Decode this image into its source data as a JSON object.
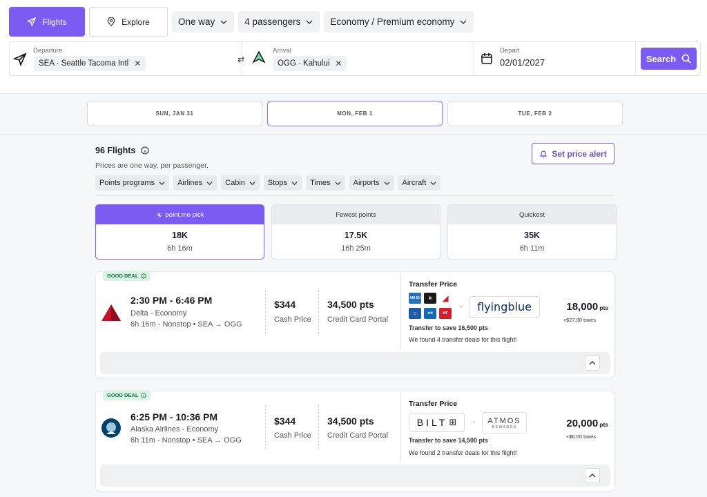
{
  "nav": {
    "flights_label": "Flights",
    "explore_label": "Explore",
    "trip_type": "One way",
    "passengers": "4 passengers",
    "cabin": "Economy / Premium economy"
  },
  "search": {
    "departure_label": "Departure",
    "departure_value": "SEA · Seattle Tacoma Intl",
    "arrival_label": "Arrival",
    "arrival_value": "OGG · Kahului",
    "depart_label": "Depart",
    "depart_value": "02/01/2027",
    "search_label": "Search"
  },
  "dates": [
    {
      "label": "SUN, JAN 31"
    },
    {
      "label": "MON, FEB 1"
    },
    {
      "label": "TUE, FEB 2"
    }
  ],
  "results": {
    "count": "96 Flights",
    "subtitle": "Prices are one way, per passenger.",
    "alert_label": "Set price alert",
    "filters": [
      "Points programs",
      "Airlines",
      "Cabin",
      "Stops",
      "Times",
      "Airports",
      "Aircraft"
    ]
  },
  "sort": [
    {
      "label": "point.me pick",
      "points": "18K",
      "duration": "6h 16m"
    },
    {
      "label": "Fewest points",
      "points": "17.5K",
      "duration": "16h 25m"
    },
    {
      "label": "Quickest",
      "points": "35K",
      "duration": "6h 11m"
    }
  ],
  "flights": [
    {
      "badge": "GOOD DEAL",
      "times": "2:30 PM  -  6:46 PM",
      "airline": "Delta - Economy",
      "route": "6h 16m - Nonstop • SEA → OGG",
      "cash": "$344",
      "cash_label": "Cash Price",
      "portal": "34,500 pts",
      "portal_label": "Credit Card Portal",
      "transfer_title": "Transfer Price",
      "program": "flyingblue",
      "save": "Transfer to save 16,500 pts",
      "found": "We found 4 transfer deals for this flight!",
      "points": "18,000",
      "pts_unit": "pts",
      "taxes": "+$27.00 taxes",
      "brand_color": "#c8102e"
    },
    {
      "badge": "GOOD DEAL",
      "times": "6:25 PM  -  10:36 PM",
      "airline": "Alaska Airlines - Economy",
      "route": "6h 11m - Nonstop • SEA → OGG",
      "cash": "$344",
      "cash_label": "Cash Price",
      "portal": "34,500 pts",
      "portal_label": "Credit Card Portal",
      "transfer_title": "Transfer Price",
      "bank": "BILT",
      "program": "ATMOS",
      "program_sub": "REWARDS",
      "save": "Transfer to save 14,500 pts",
      "found": "We found 2 transfer deals for this flight!",
      "points": "20,000",
      "pts_unit": "pts",
      "taxes": "+$6.00 taxes",
      "brand_color": "#01426a"
    }
  ],
  "colors": {
    "accent": "#7b5cf2",
    "deal_bg": "#d7f4e6",
    "deal_text": "#1d6e4a"
  }
}
